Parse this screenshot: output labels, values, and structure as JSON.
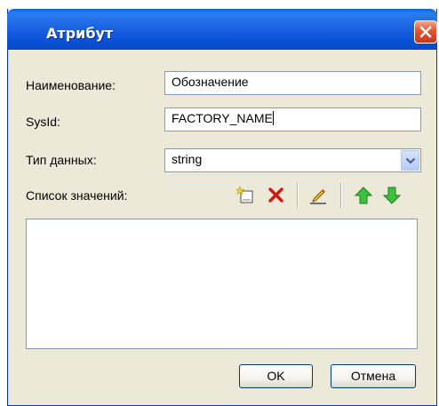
{
  "window": {
    "title": "Атрибут"
  },
  "form": {
    "name_label": "Наименование:",
    "name_value": "Обозначение",
    "sysid_label": "SysId:",
    "sysid_value": "FACTORY_NAME",
    "datatype_label": "Тип данных:",
    "datatype_value": "string",
    "values_label": "Список значений:",
    "values_items": []
  },
  "toolbar": {
    "icons": [
      "new-item-icon",
      "delete-icon",
      "edit-pencil-icon",
      "move-up-icon",
      "move-down-icon"
    ]
  },
  "buttons": {
    "ok_label": "OK",
    "cancel_label": "Отмена"
  },
  "colors": {
    "titlebar": "#0a5fe6",
    "dialog_bg": "#ece9d8",
    "close_red": "#e2542e",
    "delete_red": "#e01010",
    "arrow_green": "#2fa82f"
  }
}
